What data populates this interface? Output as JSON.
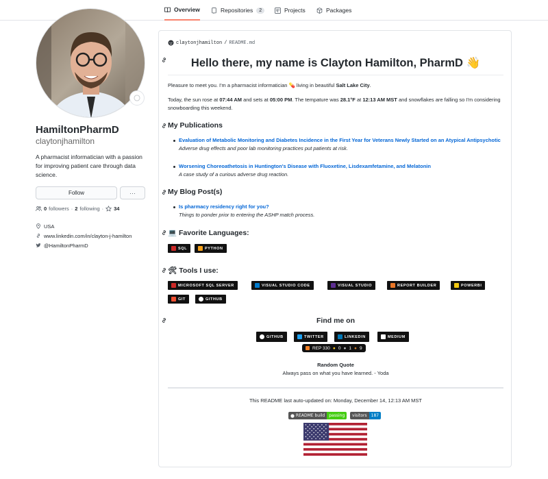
{
  "tabs": [
    {
      "label": "Overview"
    },
    {
      "label": "Repositories",
      "count": "2"
    },
    {
      "label": "Projects"
    },
    {
      "label": "Packages"
    }
  ],
  "profile": {
    "fullname": "HamiltonPharmD",
    "username": "claytonjhamilton",
    "bio": "A pharmacist informatician with a passion for improving patient care through data science.",
    "follow_label": "Follow",
    "more_label": "···",
    "followers_count": "0",
    "followers_label": "followers",
    "sep": "·",
    "following_count": "2",
    "following_label": "following",
    "stars_count": "34",
    "location": "USA",
    "website": "www.linkedin.com/in/clayton-j-hamilton",
    "twitter": "@HamiltonPharmD"
  },
  "readme": {
    "path_user": "claytonjhamilton",
    "path_sep": "/",
    "path_file": "README.md",
    "title": "Hello there, my name is Clayton Hamilton, PharmD 👋",
    "intro_before": "Pleasure to meet you. I'm a pharmacist informatician 💊 living in beautiful ",
    "intro_city": "Salt Lake City",
    "intro_after": ".",
    "weather": {
      "t1": "Today, the sun rose at ",
      "sunrise": "07:44 AM",
      "t2": " and sets at ",
      "sunset": "05:00 PM",
      "t3": ". The tempature was ",
      "temp": "28.1°F",
      "t4": " at ",
      "time": "12:13 AM MST",
      "t5": " and snowflakes are falling so I'm considering snowboarding this weekend."
    },
    "publications_heading": "My Publications",
    "publications": [
      {
        "title": "Evaluation of Metabolic Monitoring and Diabetes Incidence in the First Year for Veterans Newly Started on an Atypical Antipsychotic",
        "desc": "Adverse drug effects and poor lab monitoring practices put patients at risk."
      },
      {
        "title": "Worsening Choreoathetosis in Huntington's Disease with Fluoxetine, Lisdexamfetamine, and Melatonin",
        "desc": "A case study of a curious adverse drug reaction."
      }
    ],
    "blog_heading": "My Blog Post(s)",
    "blog": [
      {
        "title": "Is pharmacy residency right for you?",
        "desc": "Things to ponder prior to entering the ASHP match process."
      }
    ],
    "languages_heading": "💻 Favorite Languages:",
    "languages": [
      {
        "label": "SQL",
        "color": "#cc2927"
      },
      {
        "label": "PYTHON",
        "color": "#f7a21b"
      }
    ],
    "tools_heading": "🛠 Tools I use:",
    "tools": [
      {
        "label": "MICROSOFT SQL SERVER",
        "color": "#cc2927"
      },
      {
        "label": "VISUAL STUDIO CODE",
        "color": "#007acc"
      },
      {
        "label": "VISUAL STUDIO",
        "color": "#5c2d91"
      },
      {
        "label": "REPORT BUILDER",
        "color": "#e97627"
      },
      {
        "label": "POWERBI",
        "color": "#f2c811"
      },
      {
        "label": "GIT",
        "color": "#f05032"
      },
      {
        "label": "GITHUB",
        "color": "#ffffff"
      }
    ],
    "findme_heading": "Find me on",
    "socials": [
      {
        "label": "GITHUB"
      },
      {
        "label": "TWITTER"
      },
      {
        "label": "LINKEDIN"
      },
      {
        "label": "MEDIUM"
      }
    ],
    "rep_badge": {
      "rep": "REP 330",
      "gold": "0",
      "silver": "1",
      "bronze": "9"
    },
    "quote_heading": "Random Quote",
    "quote": "Always pass on what you have learned. - Yoda",
    "updated": "This README last auto-updated on: Monday, December 14, 12:13 AM MST",
    "build_badge": {
      "label": "README build",
      "status": "passing"
    },
    "visitors_badge": {
      "label": "visitors",
      "count": "187"
    }
  }
}
